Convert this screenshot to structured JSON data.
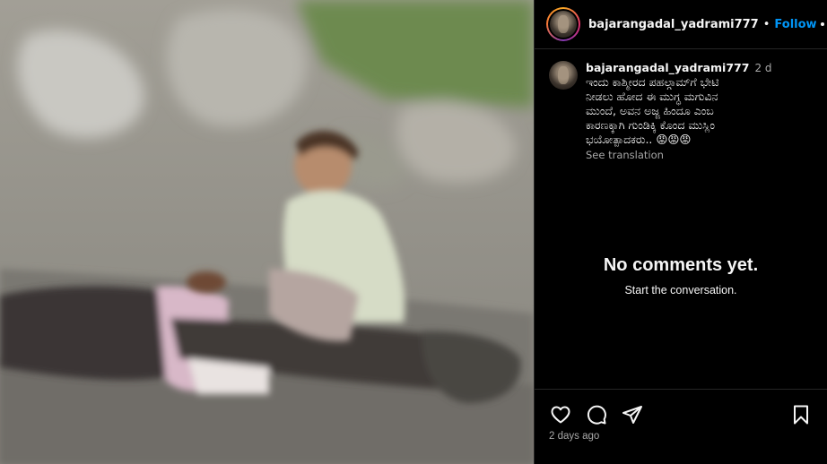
{
  "header": {
    "username": "bajarangadal_yadrami777",
    "separator": "•",
    "follow_label": "Follow",
    "more_icon": "more-horizontal-icon"
  },
  "caption": {
    "username": "bajarangadal_yadrami777",
    "time": "2 d",
    "text": "ಇಂದು ಕಾಶ್ಮೀರದ ಪಹಲ್ಗಾಮ್‌ಗೆ ಭೇಟಿ\nನೀಡಲು ಹೋದ ಈ ಮುಗ್ಧ ಮಗುವಿನ\nಮುಂದೆ, ಅವನ ಅಜ್ಜ ಹಿಂದೂ ಎಂಬ\nಕಾರಣಕ್ಕಾಗಿ ಗುಂಡಿಕ್ಕಿ ಕೊಂದ ಮುಸ್ಲಿಂ\nಭಯೋತ್ಪಾದಕರು.. 😡😡😡",
    "see_translation": "See translation"
  },
  "comments": {
    "empty_title": "No comments yet.",
    "empty_subtitle": "Start the conversation."
  },
  "actions": {
    "like_icon": "heart-icon",
    "comment_icon": "comment-icon",
    "share_icon": "share-icon",
    "save_icon": "bookmark-icon"
  },
  "post_date": "2 days ago",
  "colors": {
    "follow": "#0095f6",
    "secondary_text": "#a8a8a8",
    "divider": "#262626"
  }
}
